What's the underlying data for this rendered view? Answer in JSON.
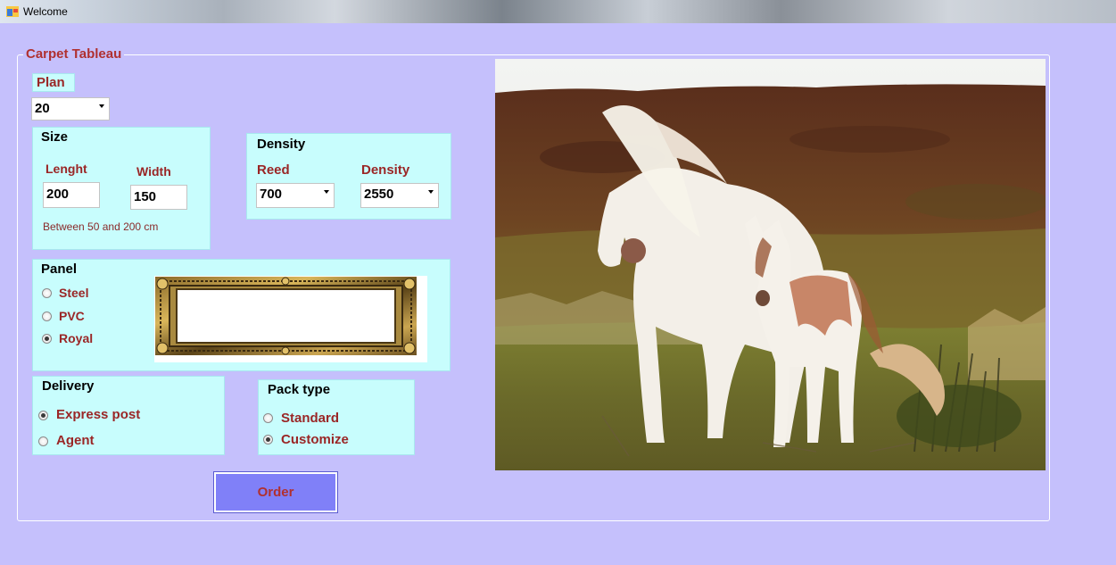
{
  "window": {
    "title": "Welcome"
  },
  "group": {
    "title": "Carpet Tableau"
  },
  "plan": {
    "label": "Plan",
    "value": "20"
  },
  "size": {
    "title": "Size",
    "length_label": "Lenght",
    "length_value": "200",
    "width_label": "Width",
    "width_value": "150",
    "hint": "Between 50 and 200 cm"
  },
  "density": {
    "title": "Density",
    "reed_label": "Reed",
    "reed_value": "700",
    "density_label": "Density",
    "density_value": "2550"
  },
  "panel": {
    "title": "Panel",
    "options": [
      {
        "label": "Steel",
        "checked": false
      },
      {
        "label": "PVC",
        "checked": false
      },
      {
        "label": "Royal",
        "checked": true
      }
    ]
  },
  "delivery": {
    "title": "Delivery",
    "options": [
      {
        "label": "Express post",
        "checked": true
      },
      {
        "label": "Agent",
        "checked": false
      }
    ]
  },
  "pack": {
    "title": "Pack type",
    "options": [
      {
        "label": "Standard",
        "checked": false
      },
      {
        "label": "Customize",
        "checked": true
      }
    ]
  },
  "order": {
    "label": "Order"
  },
  "colors": {
    "background": "#c5c0fc",
    "panel": "#c8fdfd",
    "label_red": "#9a2626",
    "button": "#8080f8"
  },
  "icons": [
    "app-window-icon",
    "dropdown-arrow-icon",
    "ornate-frame-preview",
    "horses-photo"
  ]
}
